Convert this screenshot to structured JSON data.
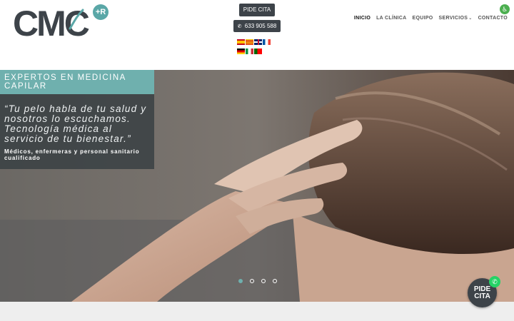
{
  "header": {
    "logo_text": "CMC",
    "logo_badge": "+R",
    "pide_cita_label": "PIDE CITA",
    "phone_label": "633 905 588",
    "phone_icon": "phone-icon",
    "languages": [
      "es",
      "ca",
      "en",
      "fr",
      "de",
      "it",
      "pt"
    ]
  },
  "nav": {
    "items": [
      {
        "label": "INICIO",
        "active": true
      },
      {
        "label": "LA CLÍNICA",
        "active": false
      },
      {
        "label": "EQUIPO",
        "active": false
      },
      {
        "label": "SERVICIOS",
        "active": false,
        "has_dropdown": true
      },
      {
        "label": "CONTACTO",
        "active": false
      }
    ],
    "dropdown_icon": "chevron-down-icon",
    "accessibility_icon": "accessibility-icon"
  },
  "hero": {
    "title": "EXPERTOS EN MEDICINA CAPILAR",
    "quote": "“Tu pelo habla de tu salud y nosotros lo escuchamos. Tecnología médica al servicio de tu bienestar.”",
    "subtitle": "Médicos, enfermeras y personal sanitario cualificado",
    "slides": 4,
    "active_slide": 1
  },
  "floating": {
    "cita_label": "PIDE CITA",
    "whatsapp_icon": "whatsapp-icon"
  },
  "colors": {
    "brand_dark": "#3d4349",
    "accent_teal": "#6fb0ae",
    "accessibility_green": "#4caf50",
    "whatsapp_green": "#25d366"
  }
}
